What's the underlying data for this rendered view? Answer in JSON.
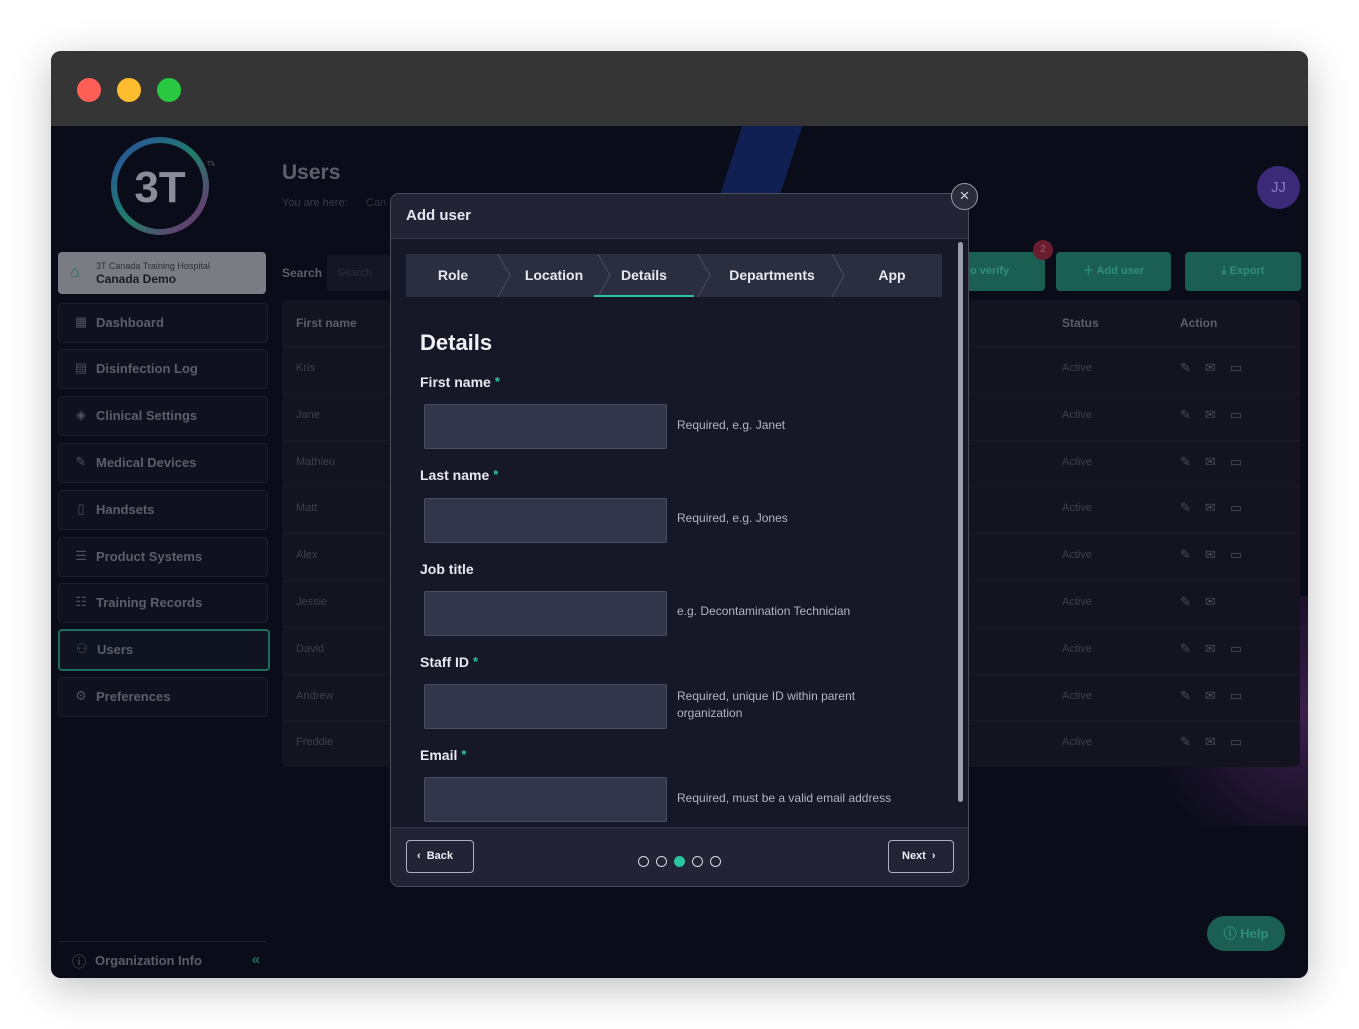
{
  "window": {
    "title_dots": [
      "close",
      "minimize",
      "zoom"
    ]
  },
  "sidebar": {
    "org_sub": "3T Canada Training Hospital",
    "org_name": "Canada Demo",
    "items": [
      {
        "label": "Dashboard",
        "icon": "grid-icon"
      },
      {
        "label": "Disinfection Log",
        "icon": "document-icon"
      },
      {
        "label": "Clinical Settings",
        "icon": "diamond-icon"
      },
      {
        "label": "Medical Devices",
        "icon": "pen-icon"
      },
      {
        "label": "Handsets",
        "icon": "phone-icon"
      },
      {
        "label": "Product Systems",
        "icon": "list-icon"
      },
      {
        "label": "Training Records",
        "icon": "checklist-icon"
      },
      {
        "label": "Users",
        "icon": "users-icon"
      },
      {
        "label": "Preferences",
        "icon": "gear-icon"
      }
    ],
    "footer": "Organization Info"
  },
  "main": {
    "title": "Users",
    "breadcrumb_label": "You are here:",
    "breadcrumb_value": "Can",
    "search_label": "Search",
    "search_placeholder": "Search",
    "avatar": "JJ",
    "badge_count": "2",
    "verify_label": "o verify",
    "add_user_label": "Add user",
    "export_label": "Export",
    "columns": {
      "first_name": "First name",
      "status": "Status",
      "action": "Action"
    },
    "rows": [
      {
        "first": "Kris",
        "status": "Active"
      },
      {
        "first": "Jane",
        "status": "Active"
      },
      {
        "first": "Mathieu",
        "status": "Active"
      },
      {
        "first": "Matt",
        "status": "Active"
      },
      {
        "first": "Alex",
        "status": "Active"
      },
      {
        "first": "Jessie",
        "status": "Active"
      },
      {
        "first": "David",
        "status": "Active"
      },
      {
        "first": "Andrew",
        "status": "Active"
      },
      {
        "first": "Freddie",
        "status": "Active"
      }
    ],
    "help_label": "Help"
  },
  "modal": {
    "title": "Add user",
    "steps": [
      "Role",
      "Location",
      "Details",
      "Departments",
      "App"
    ],
    "active_step": "Details",
    "section_title": "Details",
    "fields": [
      {
        "label": "First name",
        "required": true,
        "value": "",
        "hint": "Required, e.g. Janet"
      },
      {
        "label": "Last name",
        "required": true,
        "value": "",
        "hint": "Required, e.g. Jones"
      },
      {
        "label": "Job title",
        "required": false,
        "value": "",
        "hint": "e.g. Decontamination Technician"
      },
      {
        "label": "Staff ID",
        "required": true,
        "value": "",
        "hint": "Required, unique ID within parent organization"
      },
      {
        "label": "Email",
        "required": true,
        "value": "",
        "hint": "Required, must be a valid email address"
      }
    ],
    "required_mark": "*",
    "back_label": "Back",
    "next_label": "Next",
    "page_index": 3,
    "page_total": 5
  },
  "colors": {
    "accent": "#2bc4a1",
    "modal_bg": "#161828",
    "header_bg": "#222435"
  }
}
